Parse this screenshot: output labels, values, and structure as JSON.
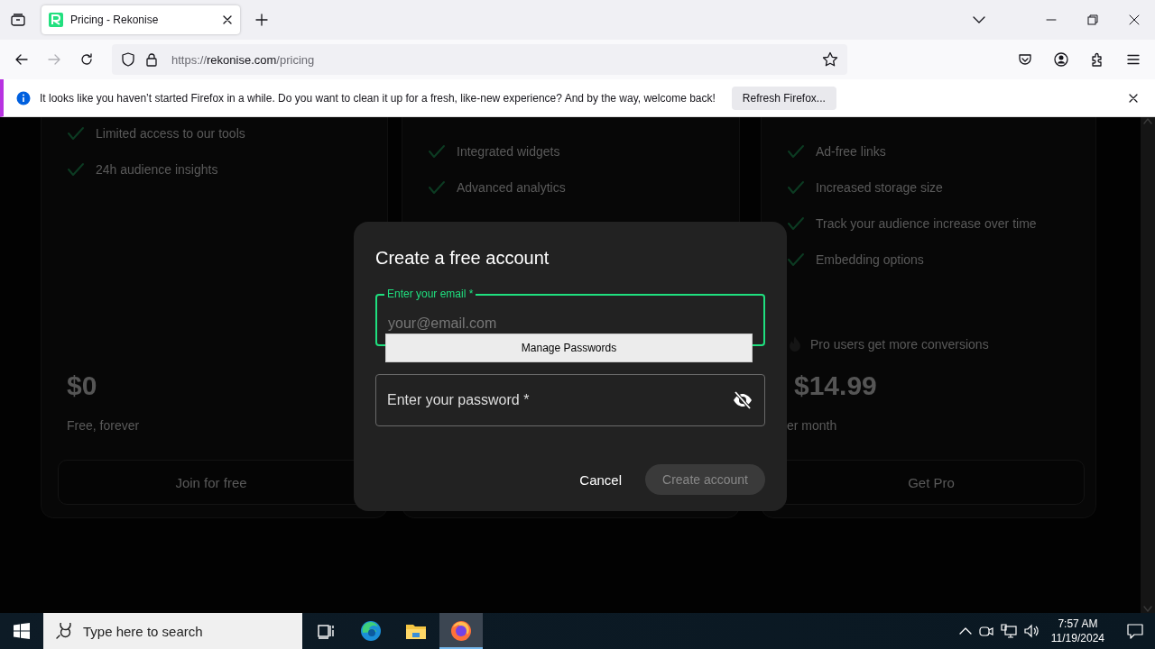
{
  "browser": {
    "tabs": [
      {
        "title": "Pricing - Rekonise",
        "selected": true
      }
    ],
    "url": {
      "scheme": "https://",
      "domain": "rekonise.com",
      "path": "/pricing"
    }
  },
  "notification": {
    "message": "It looks like you haven’t started Firefox in a while. Do you want to clean it up for a fresh, like-new experience? And by the way, welcome back!",
    "button": "Refresh Firefox..."
  },
  "plans": [
    {
      "features": [
        "Limited access to our tools",
        "24h audience insights"
      ],
      "price": "$0",
      "period": "Free, forever",
      "button": "Join for free"
    },
    {
      "features": [
        "Integrated widgets",
        "Advanced analytics"
      ]
    },
    {
      "features": [
        "Ad-free links",
        "Increased storage size",
        "Track your audience increase over time",
        "Embedding options"
      ],
      "note": "Pro users get more conversions",
      "price": "$14.99",
      "period": "er month",
      "button": "Get Pro"
    }
  ],
  "dialog": {
    "title": "Create a free account",
    "fields": [
      {
        "kind": "email",
        "label": "Enter your email *",
        "placeholder": "your@email.com",
        "focused": true
      },
      {
        "kind": "password",
        "label": "Enter your password *",
        "focused": false
      }
    ],
    "autocomplete": "Manage Passwords",
    "buttons": [
      {
        "kind": "text",
        "label": "Cancel",
        "disabled": false
      },
      {
        "kind": "filled",
        "label": "Create account",
        "disabled": true
      }
    ]
  },
  "taskbar": {
    "search_placeholder": "Type here to search",
    "apps": [
      {
        "kind": "taskview",
        "selected": false
      },
      {
        "kind": "edge",
        "selected": false
      },
      {
        "kind": "explorer",
        "selected": false
      },
      {
        "kind": "firefox",
        "selected": true
      }
    ],
    "time": "7:57 AM",
    "date": "11/19/2024"
  }
}
